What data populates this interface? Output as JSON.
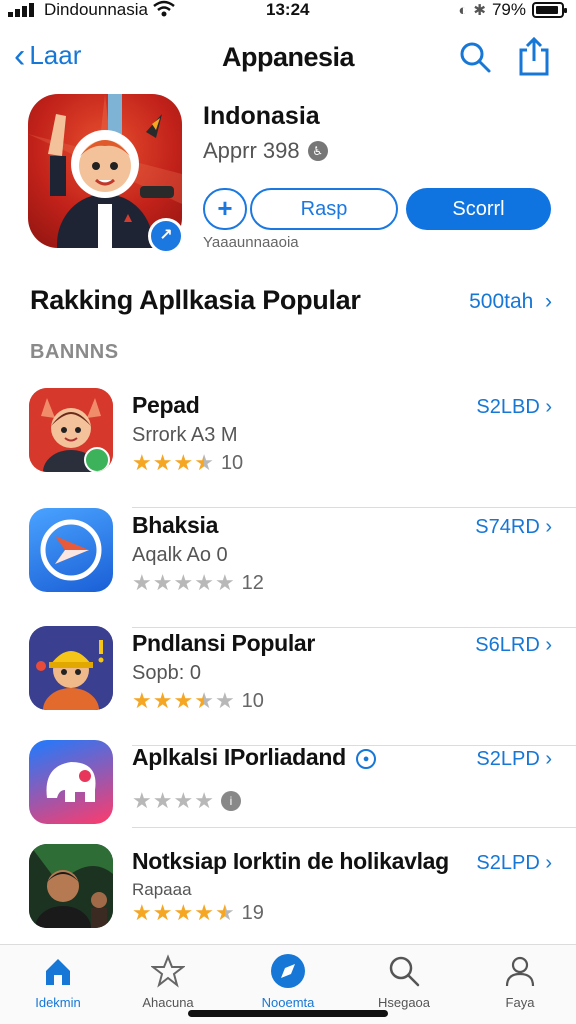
{
  "status": {
    "carrier": "Dindounnasia",
    "time": "13:24",
    "battery": "79%"
  },
  "nav": {
    "back_label": "Laar",
    "title": "Appanesia"
  },
  "hero": {
    "name": "Indonasia",
    "subtitle": "Apprr 398",
    "btn_plus": "+",
    "btn_secondary": "Rasp",
    "btn_primary": "Scorrl",
    "footer": "Yaaaunnaaoia"
  },
  "section": {
    "title": "Rakking Apllkasia Popular",
    "link": "500tah",
    "subtitle": "BANNNS"
  },
  "apps": [
    {
      "name": "Pepad",
      "sub": "Srrork A3  M",
      "rating": 3.5,
      "count": "10",
      "price": "S2LBD"
    },
    {
      "name": "Bhaksia",
      "sub": "Aqalk Ao   0",
      "rating": 0,
      "count": "12",
      "price": "S74RD"
    },
    {
      "name": "Pndlansi Popular",
      "sub": "Sopb:     0",
      "rating": 3.5,
      "count": "10",
      "price": "S6LRD"
    },
    {
      "name": "Aplkalsi IPorliadand",
      "sub": "",
      "rating": 0,
      "count": "",
      "price": "S2LPD"
    },
    {
      "name": "Notksiap Iorktin de holikavlag",
      "sub": "Rapaaa",
      "rating": 4.5,
      "count": "19",
      "price": "S2LPD"
    }
  ],
  "tabs": [
    {
      "label": "Idekmin",
      "icon": "home-icon"
    },
    {
      "label": "Ahacuna",
      "icon": "star-icon"
    },
    {
      "label": "Nooemta",
      "icon": "compass-icon"
    },
    {
      "label": "Hsegaoa",
      "icon": "search-icon"
    },
    {
      "label": "Faya",
      "icon": "person-icon"
    }
  ],
  "colors": {
    "accent": "#1677d6",
    "star": "#f5a623"
  }
}
